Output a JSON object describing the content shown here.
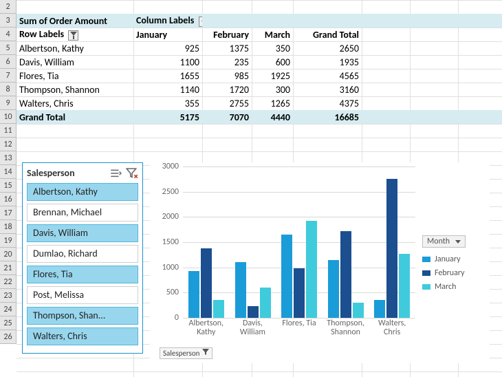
{
  "pivot": {
    "header1": {
      "a": "Sum of Order Amount",
      "b": "Column Labels"
    },
    "header2": {
      "a": "Row Labels",
      "b": "January",
      "c": "February",
      "d": "March",
      "e": "Grand Total"
    },
    "rows": [
      {
        "name": "Albertson, Kathy",
        "jan": "925",
        "feb": "1375",
        "mar": "350",
        "tot": "2650"
      },
      {
        "name": "Davis, William",
        "jan": "1100",
        "feb": "235",
        "mar": "600",
        "tot": "1935"
      },
      {
        "name": "Flores, Tia",
        "jan": "1655",
        "feb": "985",
        "mar": "1925",
        "tot": "4565"
      },
      {
        "name": "Thompson, Shannon",
        "jan": "1140",
        "feb": "1720",
        "mar": "300",
        "tot": "3160"
      },
      {
        "name": "Walters, Chris",
        "jan": "355",
        "feb": "2755",
        "mar": "1265",
        "tot": "4375"
      }
    ],
    "grand": {
      "label": "Grand Total",
      "jan": "5175",
      "feb": "7070",
      "mar": "4440",
      "tot": "16685"
    }
  },
  "slicer": {
    "title": "Salesperson",
    "items": [
      {
        "label": "Albertson, Kathy",
        "selected": true
      },
      {
        "label": "Brennan, Michael",
        "selected": false
      },
      {
        "label": "Davis, William",
        "selected": true
      },
      {
        "label": "Dumlao, Richard",
        "selected": false
      },
      {
        "label": "Flores, Tia",
        "selected": true
      },
      {
        "label": "Post, Melissa",
        "selected": false
      },
      {
        "label": "Thompson, Shan...",
        "selected": true
      },
      {
        "label": "Walters, Chris",
        "selected": true
      }
    ]
  },
  "chart": {
    "legend_title": "Month",
    "series_labels": {
      "s1": "January",
      "s2": "February",
      "s3": "March"
    },
    "field_button": "Salesperson",
    "yticks": [
      "0",
      "500",
      "1000",
      "1500",
      "2000",
      "2500",
      "3000"
    ],
    "categories": [
      {
        "line1": "Albertson,",
        "line2": "Kathy"
      },
      {
        "line1": "Davis,",
        "line2": "William"
      },
      {
        "line1": "Flores, Tia",
        "line2": ""
      },
      {
        "line1": "Thompson,",
        "line2": "Shannon"
      },
      {
        "line1": "Walters,",
        "line2": "Chris"
      }
    ]
  },
  "row_numbers": [
    "2",
    "3",
    "4",
    "5",
    "6",
    "7",
    "8",
    "9",
    "10",
    "11",
    "12",
    "13",
    "14",
    "15",
    "16",
    "17",
    "18",
    "19",
    "20",
    "21",
    "22",
    "23",
    "24",
    "25",
    "26"
  ],
  "chart_data": {
    "type": "bar",
    "categories": [
      "Albertson, Kathy",
      "Davis, William",
      "Flores, Tia",
      "Thompson, Shannon",
      "Walters, Chris"
    ],
    "series": [
      {
        "name": "January",
        "values": [
          925,
          1100,
          1655,
          1140,
          355
        ]
      },
      {
        "name": "February",
        "values": [
          1375,
          235,
          985,
          1720,
          2755
        ]
      },
      {
        "name": "March",
        "values": [
          350,
          600,
          1925,
          300,
          1265
        ]
      }
    ],
    "ylabel": "",
    "xlabel": "",
    "ylim": [
      0,
      3000
    ],
    "title": ""
  }
}
